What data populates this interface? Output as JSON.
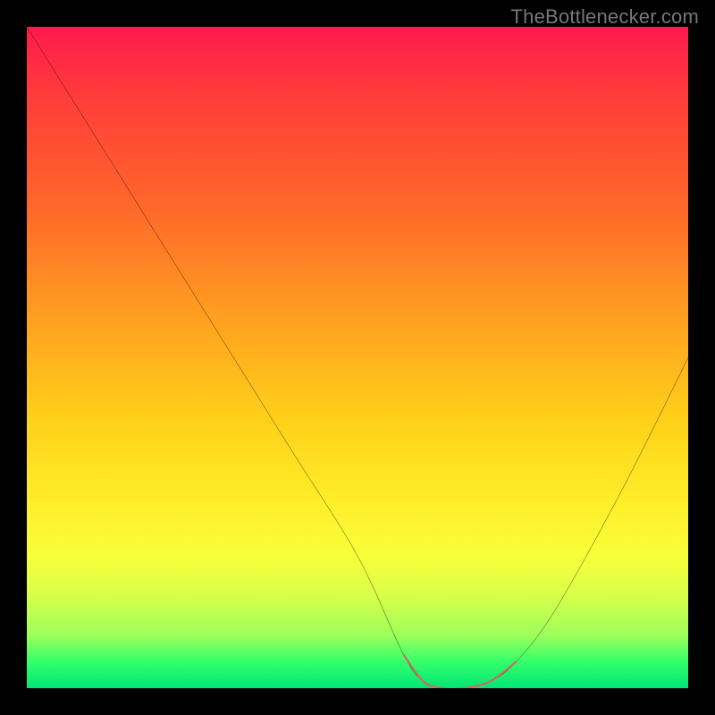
{
  "source_label": "TheBottlenecker.com",
  "chart_data": {
    "type": "line",
    "title": "",
    "xlabel": "",
    "ylabel": "",
    "xlim": [
      0,
      100
    ],
    "ylim": [
      0,
      100
    ],
    "series": [
      {
        "name": "main-curve",
        "color": "#000000",
        "x": [
          0,
          10,
          20,
          30,
          40,
          50,
          57,
          60,
          63,
          66,
          70,
          74,
          80,
          90,
          100
        ],
        "y": [
          100,
          84,
          68,
          52,
          36,
          20,
          5,
          1,
          0,
          0,
          1,
          4,
          12,
          30,
          50
        ]
      },
      {
        "name": "trough-highlight",
        "color": "#d46a5e",
        "x": [
          57,
          60,
          63,
          66,
          70,
          74
        ],
        "y": [
          5,
          1,
          0,
          0,
          1,
          4
        ]
      }
    ],
    "gradient_stops": [
      {
        "pos": 0,
        "color": "#ff1a4d"
      },
      {
        "pos": 28,
        "color": "#ff6a2a"
      },
      {
        "pos": 60,
        "color": "#ffd21a"
      },
      {
        "pos": 86,
        "color": "#d8ff4a"
      },
      {
        "pos": 100,
        "color": "#00e676"
      }
    ]
  }
}
